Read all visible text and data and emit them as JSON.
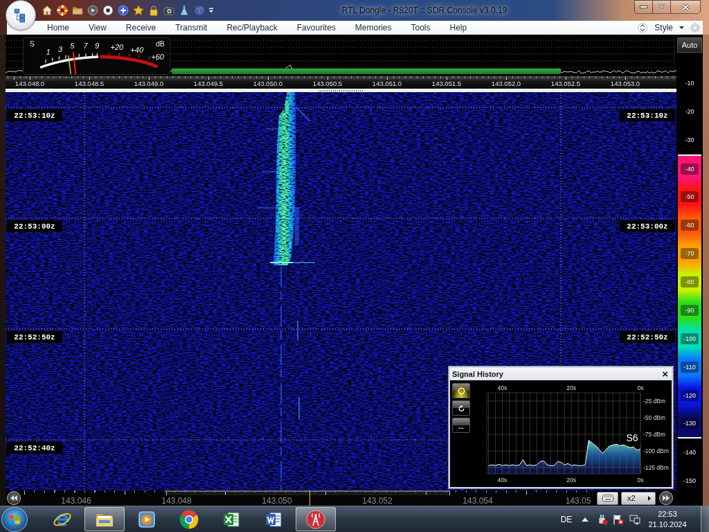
{
  "window": {
    "title": "RTL Dongle - R820T :: SDR Console v3.0.19"
  },
  "menu": {
    "items": [
      "Home",
      "View",
      "Receive",
      "Transmit",
      "Rec/Playback",
      "Favourites",
      "Memories",
      "Tools",
      "Help"
    ],
    "style_label": "Style"
  },
  "s_meter": {
    "s_unit": "S",
    "db_unit": "dB",
    "s_marks": [
      "1",
      "3",
      "5",
      "7",
      "9"
    ],
    "db_marks": [
      "+20",
      "+40",
      "+60"
    ],
    "level": 0.31
  },
  "frequency_axis": [
    "143.048.0",
    "143.048.5",
    "143.049.0",
    "143.049.5",
    "143.050.0",
    "143.050.5",
    "143.051.0",
    "143.051.5",
    "143.052.0",
    "143.052.5",
    "143.053.0"
  ],
  "waterfall": {
    "left_times": [
      "22:53:10z",
      "22:53:00z",
      "22:52:50z",
      "22:52:40z"
    ],
    "right_times": [
      "22:53:10z",
      "22:53:00z",
      "22:52:50z"
    ]
  },
  "colour_scale": {
    "auto_label": "Auto",
    "marks": [
      {
        "label": "-10"
      },
      {
        "label": "-20"
      },
      {
        "label": "-30"
      },
      {
        "label": "-40",
        "color": "#ff1478"
      },
      {
        "label": "-50",
        "color": "#ff1414"
      },
      {
        "label": "-60",
        "color": "#ff5a0a"
      },
      {
        "label": "-70",
        "color": "#ffa000"
      },
      {
        "label": "-80",
        "color": "#c8f000"
      },
      {
        "label": "-90",
        "color": "#28e01c"
      },
      {
        "label": "-100",
        "color": "#00e0b4"
      },
      {
        "label": "-110",
        "color": "#0a78ff"
      },
      {
        "label": "-120",
        "color": "#0a14e0"
      },
      {
        "label": "-130",
        "color": "#050a6a"
      },
      {
        "label": "-140"
      },
      {
        "label": "-150"
      }
    ]
  },
  "signal_history": {
    "title": "Signal History",
    "close_label": "×",
    "buttons": [
      {
        "kind": "ring",
        "selected": true
      },
      {
        "kind": "refresh",
        "selected": false
      },
      {
        "kind": "more",
        "label": "...",
        "selected": false
      }
    ],
    "top_ticks": [
      "40s",
      "20s",
      "0s"
    ],
    "reading": "S6",
    "chart_data": {
      "type": "area",
      "x": [
        44,
        43,
        42,
        41,
        40,
        39,
        38,
        37,
        36,
        35,
        34,
        33,
        32,
        31,
        30,
        29,
        28,
        27,
        26,
        25,
        24,
        23,
        22,
        21,
        20,
        19,
        18,
        17,
        16,
        15,
        14,
        13,
        12,
        11,
        10,
        9,
        8,
        7,
        6,
        5,
        4,
        3,
        2,
        1,
        0
      ],
      "series": [
        {
          "color": "#ffffff",
          "values": [
            -122,
            -121,
            -122,
            -120,
            -122,
            -121,
            -122,
            -121,
            -122,
            -121,
            -113,
            -122,
            -121,
            -122,
            -121,
            -116,
            -115,
            -121,
            -122,
            -122,
            -116,
            -117,
            -121,
            -119,
            -122,
            -121,
            -122,
            -122,
            -121,
            -84,
            -88,
            -92,
            -97,
            -104,
            -98,
            -93,
            -91,
            -90,
            -92,
            -91,
            -93,
            -95,
            -94,
            -99,
            -97
          ]
        }
      ],
      "xlim": [
        44.5,
        0
      ],
      "ylim": [
        -134.4,
        -12.5
      ],
      "xticks": [
        {
          "value": 40,
          "label": "40s"
        },
        {
          "value": 20,
          "label": "20s"
        },
        {
          "value": 0,
          "label": "0s"
        }
      ],
      "yticks": [
        {
          "value": -25,
          "label": "-25 dBm"
        },
        {
          "value": -50,
          "label": "-50 dBm"
        },
        {
          "value": -75,
          "label": "-75 dBm"
        },
        {
          "value": -100,
          "label": "-100 dBm"
        },
        {
          "value": -125,
          "label": "-125 dBm"
        }
      ],
      "grid": true
    }
  },
  "bottom_bar": {
    "overview_labels": [
      "143.046",
      "143.048",
      "143.050",
      "143.052",
      "143.054",
      "143.05"
    ],
    "zoom_label": "x2"
  },
  "taskbar": {
    "apps": [
      {
        "kind": "browser-e",
        "selected": false
      },
      {
        "kind": "folder",
        "selected": true
      },
      {
        "kind": "media",
        "selected": false
      },
      {
        "kind": "round-browser",
        "selected": false
      },
      {
        "kind": "sheet",
        "selected": false
      },
      {
        "kind": "doc",
        "selected": false
      },
      {
        "kind": "antenna",
        "selected": true
      }
    ],
    "language": "DE",
    "time": "22:53",
    "date": "21.10.2024"
  }
}
